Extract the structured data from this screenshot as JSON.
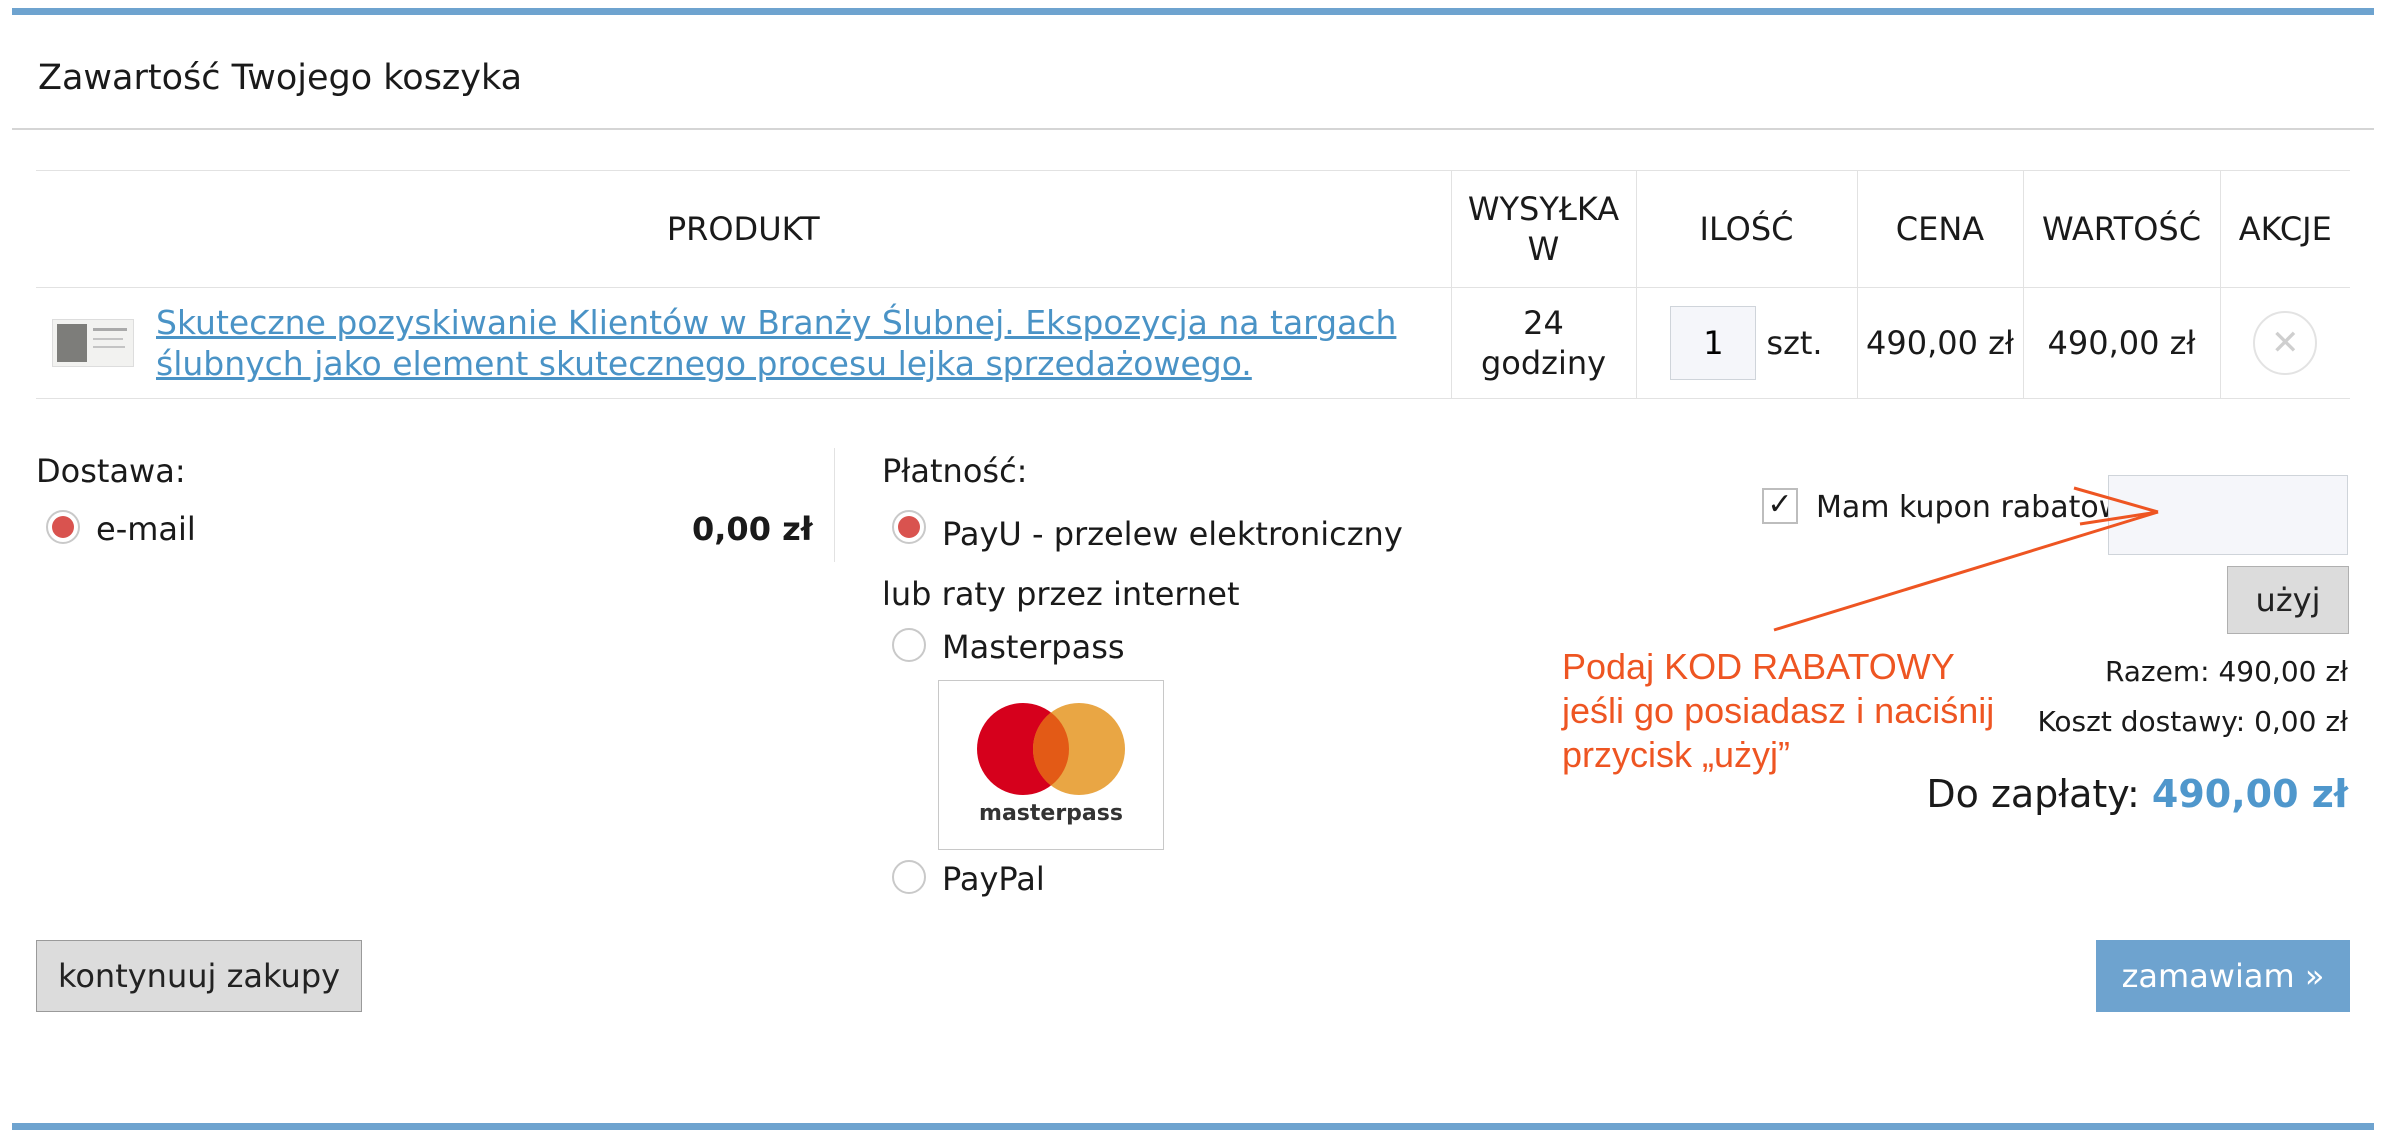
{
  "cart": {
    "title": "Zawartość Twojego koszyka",
    "columns": {
      "product": "PRODUKT",
      "shipping": "WYSYŁKA W",
      "quantity": "ILOŚĆ",
      "price": "CENA",
      "value": "WARTOŚĆ",
      "actions": "AKCJE"
    },
    "items": [
      {
        "name": "Skuteczne pozyskiwanie Klientów w Branży Ślubnej. Ekspozycja na targach ślubnych jako element skutecznego procesu lejka sprzedażowego.",
        "shipping": "24 godziny",
        "quantity": "1",
        "unit": "szt.",
        "price": "490,00 zł",
        "value": "490,00 zł",
        "remove_icon": "close-icon"
      }
    ]
  },
  "delivery": {
    "label": "Dostawa:",
    "options": [
      {
        "label": "e-mail",
        "price": "0,00 zł",
        "selected": true
      }
    ]
  },
  "payment": {
    "label": "Płatność:",
    "options": [
      {
        "label": "PayU - przelew elektroniczny lub raty przez internet",
        "selected": true
      },
      {
        "label": "Masterpass",
        "selected": false,
        "logo_text": "masterpass"
      },
      {
        "label": "PayPal",
        "selected": false
      }
    ]
  },
  "coupon": {
    "checkbox_label": "Mam kupon rabatowy",
    "checked": true,
    "input_value": "",
    "use_button": "użyj",
    "annotation": [
      "Podaj KOD RABATOWY",
      "jeśli go posiadasz i naciśnij",
      "przycisk „użyj”"
    ],
    "annotation_color": "#ee5522"
  },
  "summary": {
    "subtotal": "Razem: 490,00 zł",
    "shipping_cost": "Koszt dostawy: 0,00 zł",
    "due_label": "Do zapłaty:",
    "due_amount": "490,00 zł"
  },
  "actions": {
    "continue": "kontynuuj zakupy",
    "order": "zamawiam »"
  },
  "colors": {
    "accent": "#6ea3cf",
    "link": "#4a93c6",
    "radio_selected": "#d9534f",
    "mastercard_red": "#d6001c",
    "mastercard_orange": "#e8a13a"
  }
}
